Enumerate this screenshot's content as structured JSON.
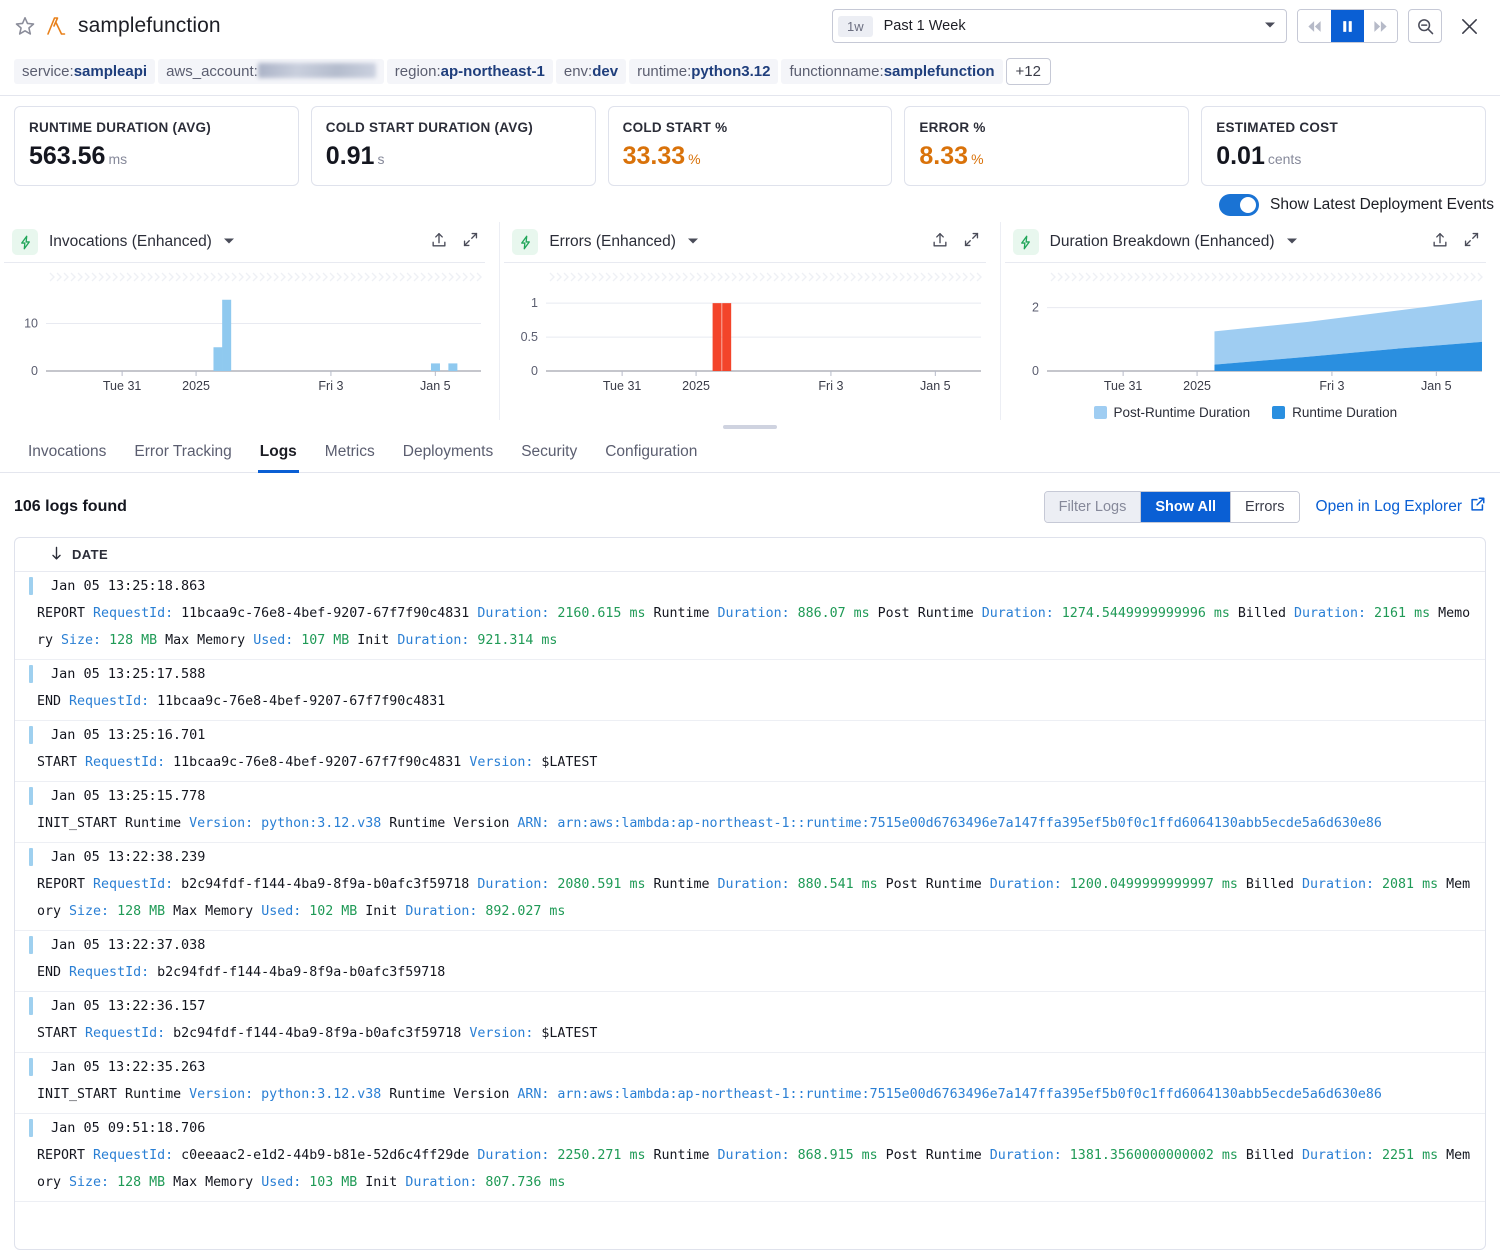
{
  "header": {
    "function_name": "samplefunction",
    "star_icon": "star-icon",
    "lambda_icon": "aws-lambda-icon",
    "timepicker": {
      "badge": "1w",
      "label": "Past 1 Week",
      "caret": "▼"
    },
    "controls": {
      "prev": "⏪",
      "pause": "❚❚",
      "next": "⏩",
      "zoom_out": "zoom-out-icon",
      "close": "✕"
    }
  },
  "tags": [
    {
      "key": "service:",
      "value": "sampleapi",
      "redacted": false
    },
    {
      "key": "aws_account:",
      "value": "",
      "redacted": true
    },
    {
      "key": "region:",
      "value": "ap-northeast-1",
      "redacted": false
    },
    {
      "key": "env:",
      "value": "dev",
      "redacted": false
    },
    {
      "key": "runtime:",
      "value": "python3.12",
      "redacted": false
    },
    {
      "key": "functionname:",
      "value": "samplefunction",
      "redacted": false
    }
  ],
  "tags_more": "+12",
  "cards": [
    {
      "title": "RUNTIME DURATION (AVG)",
      "value": "563.56",
      "unit": "ms",
      "warn": false
    },
    {
      "title": "COLD START DURATION (AVG)",
      "value": "0.91",
      "unit": "s",
      "warn": false
    },
    {
      "title": "COLD START %",
      "value": "33.33",
      "unit": "%",
      "warn": true
    },
    {
      "title": "ERROR %",
      "value": "8.33",
      "unit": "%",
      "warn": true
    },
    {
      "title": "ESTIMATED COST",
      "value": "0.01",
      "unit": "cents",
      "warn": false
    }
  ],
  "deployment_toggle": {
    "label": "Show Latest Deployment Events",
    "on": true,
    "color": "#1a73d4"
  },
  "charts": [
    {
      "title": "Invocations (Enhanced)",
      "icon": "lightning-bolt-icon",
      "caret": "▼",
      "export_icon": "export-icon",
      "expand_icon": "expand-icon"
    },
    {
      "title": "Errors (Enhanced)",
      "icon": "lightning-bolt-icon",
      "caret": "▼",
      "export_icon": "export-icon",
      "expand_icon": "expand-icon"
    },
    {
      "title": "Duration Breakdown (Enhanced)",
      "icon": "lightning-bolt-icon",
      "caret": "▼",
      "export_icon": "export-icon",
      "expand_icon": "expand-icon"
    }
  ],
  "chart_data": [
    {
      "type": "bar",
      "title": "Invocations (Enhanced)",
      "xlabel": "",
      "ylabel": "",
      "x_ticks": [
        "Tue 31",
        "2025",
        "Fri 3",
        "Jan 5"
      ],
      "y_ticks": [
        "0",
        "10"
      ],
      "ylim": [
        0,
        16
      ],
      "grid": true,
      "color": "#8fc9ef",
      "points": [
        {
          "x": 0.385,
          "value": 5
        },
        {
          "x": 0.405,
          "value": 15
        },
        {
          "x": 0.885,
          "value": 1.6
        },
        {
          "x": 0.925,
          "value": 1.6
        }
      ]
    },
    {
      "type": "bar",
      "title": "Errors (Enhanced)",
      "xlabel": "",
      "ylabel": "",
      "x_ticks": [
        "Tue 31",
        "2025",
        "Fri 3",
        "Jan 5"
      ],
      "y_ticks": [
        "0",
        "0.5",
        "1"
      ],
      "ylim": [
        0,
        1.12
      ],
      "grid": true,
      "color": "#f3442a",
      "points": [
        {
          "x": 0.383,
          "value": 1
        },
        {
          "x": 0.405,
          "value": 1
        }
      ]
    },
    {
      "type": "area",
      "title": "Duration Breakdown (Enhanced)",
      "xlabel": "",
      "ylabel": "",
      "x_ticks": [
        "Tue 31",
        "2025",
        "Fri 3",
        "Jan 5"
      ],
      "y_ticks": [
        "0",
        "2"
      ],
      "ylim": [
        0,
        2.4
      ],
      "grid": true,
      "legend_position": "bottom",
      "x": [
        0.385,
        0.6,
        0.8,
        1.0
      ],
      "series": [
        {
          "name": "Runtime Duration",
          "color": "#2a8fe0",
          "values": [
            0.2,
            0.45,
            0.7,
            0.92
          ]
        },
        {
          "name": "Post-Runtime Duration",
          "color": "#9fcdf2",
          "values": [
            1.25,
            1.55,
            1.9,
            2.25
          ]
        }
      ]
    }
  ],
  "tabs": [
    {
      "label": "Invocations",
      "active": false
    },
    {
      "label": "Error Tracking",
      "active": false
    },
    {
      "label": "Logs",
      "active": true
    },
    {
      "label": "Metrics",
      "active": false
    },
    {
      "label": "Deployments",
      "active": false
    },
    {
      "label": "Security",
      "active": false
    },
    {
      "label": "Configuration",
      "active": false
    }
  ],
  "logs_toolbar": {
    "count_text": "106 logs found",
    "filter_label": "Filter Logs",
    "show_all_label": "Show All",
    "errors_label": "Errors",
    "open_explorer_label": "Open in Log Explorer",
    "external_icon": "external-link-icon"
  },
  "log_table": {
    "sort_icon": "↓",
    "date_column": "DATE",
    "entries": [
      {
        "date": "Jan 05 13:25:18.863",
        "parts": [
          {
            "t": "REPORT ",
            "c": "plain"
          },
          {
            "t": "RequestId:",
            "c": "key"
          },
          {
            "t": " 11bcaa9c-76e8-4bef-9207-67f7f90c4831 ",
            "c": "plain"
          },
          {
            "t": "Duration:",
            "c": "key"
          },
          {
            "t": " 2160.615 ms",
            "c": "val"
          },
          {
            "t": " Runtime ",
            "c": "plain"
          },
          {
            "t": "Duration:",
            "c": "key"
          },
          {
            "t": " 886.07 ms",
            "c": "val"
          },
          {
            "t": " Post Runtime ",
            "c": "plain"
          },
          {
            "t": "Duration:",
            "c": "key"
          },
          {
            "t": " 1274.5449999999996 ms",
            "c": "val"
          },
          {
            "t": " Billed ",
            "c": "plain"
          },
          {
            "t": "Duration:",
            "c": "key"
          },
          {
            "t": " 2161 ms",
            "c": "val"
          },
          {
            "t": " Memory ",
            "c": "plain"
          },
          {
            "t": "Size:",
            "c": "key"
          },
          {
            "t": " 128 MB",
            "c": "val"
          },
          {
            "t": " Max Memory ",
            "c": "plain"
          },
          {
            "t": "Used:",
            "c": "key"
          },
          {
            "t": " 107 MB",
            "c": "val"
          },
          {
            "t": " Init ",
            "c": "plain"
          },
          {
            "t": "Duration:",
            "c": "key"
          },
          {
            "t": " 921.314 ms",
            "c": "val"
          }
        ]
      },
      {
        "date": "Jan 05 13:25:17.588",
        "parts": [
          {
            "t": "END ",
            "c": "plain"
          },
          {
            "t": "RequestId:",
            "c": "key"
          },
          {
            "t": " 11bcaa9c-76e8-4bef-9207-67f7f90c4831",
            "c": "plain"
          }
        ]
      },
      {
        "date": "Jan 05 13:25:16.701",
        "parts": [
          {
            "t": "START ",
            "c": "plain"
          },
          {
            "t": "RequestId:",
            "c": "key"
          },
          {
            "t": " 11bcaa9c-76e8-4bef-9207-67f7f90c4831 ",
            "c": "plain"
          },
          {
            "t": "Version:",
            "c": "key"
          },
          {
            "t": " $LATEST",
            "c": "plain"
          }
        ]
      },
      {
        "date": "Jan 05 13:25:15.778",
        "parts": [
          {
            "t": "INIT_START Runtime ",
            "c": "plain"
          },
          {
            "t": "Version:",
            "c": "key"
          },
          {
            "t": " python:3.12.v38",
            "c": "link"
          },
          {
            "t": " Runtime Version ",
            "c": "plain"
          },
          {
            "t": "ARN:",
            "c": "key"
          },
          {
            "t": " arn:aws:lambda:ap-northeast-1::runtime:7515e00d6763496e7a147ffa395ef5b0f0c1ffd6064130abb5ecde5a6d630e86",
            "c": "link"
          }
        ]
      },
      {
        "date": "Jan 05 13:22:38.239",
        "parts": [
          {
            "t": "REPORT ",
            "c": "plain"
          },
          {
            "t": "RequestId:",
            "c": "key"
          },
          {
            "t": " b2c94fdf-f144-4ba9-8f9a-b0afc3f59718 ",
            "c": "plain"
          },
          {
            "t": "Duration:",
            "c": "key"
          },
          {
            "t": " 2080.591 ms",
            "c": "val"
          },
          {
            "t": " Runtime ",
            "c": "plain"
          },
          {
            "t": "Duration:",
            "c": "key"
          },
          {
            "t": " 880.541 ms",
            "c": "val"
          },
          {
            "t": " Post Runtime ",
            "c": "plain"
          },
          {
            "t": "Duration:",
            "c": "key"
          },
          {
            "t": " 1200.0499999999997 ms",
            "c": "val"
          },
          {
            "t": " Billed ",
            "c": "plain"
          },
          {
            "t": "Duration:",
            "c": "key"
          },
          {
            "t": " 2081 ms",
            "c": "val"
          },
          {
            "t": " Memory ",
            "c": "plain"
          },
          {
            "t": "Size:",
            "c": "key"
          },
          {
            "t": " 128 MB",
            "c": "val"
          },
          {
            "t": " Max Memory ",
            "c": "plain"
          },
          {
            "t": "Used:",
            "c": "key"
          },
          {
            "t": " 102 MB",
            "c": "val"
          },
          {
            "t": " Init ",
            "c": "plain"
          },
          {
            "t": "Duration:",
            "c": "key"
          },
          {
            "t": " 892.027 ms",
            "c": "val"
          }
        ]
      },
      {
        "date": "Jan 05 13:22:37.038",
        "parts": [
          {
            "t": "END ",
            "c": "plain"
          },
          {
            "t": "RequestId:",
            "c": "key"
          },
          {
            "t": " b2c94fdf-f144-4ba9-8f9a-b0afc3f59718",
            "c": "plain"
          }
        ]
      },
      {
        "date": "Jan 05 13:22:36.157",
        "parts": [
          {
            "t": "START ",
            "c": "plain"
          },
          {
            "t": "RequestId:",
            "c": "key"
          },
          {
            "t": " b2c94fdf-f144-4ba9-8f9a-b0afc3f59718 ",
            "c": "plain"
          },
          {
            "t": "Version:",
            "c": "key"
          },
          {
            "t": " $LATEST",
            "c": "plain"
          }
        ]
      },
      {
        "date": "Jan 05 13:22:35.263",
        "parts": [
          {
            "t": "INIT_START Runtime ",
            "c": "plain"
          },
          {
            "t": "Version:",
            "c": "key"
          },
          {
            "t": " python:3.12.v38",
            "c": "link"
          },
          {
            "t": " Runtime Version ",
            "c": "plain"
          },
          {
            "t": "ARN:",
            "c": "key"
          },
          {
            "t": " arn:aws:lambda:ap-northeast-1::runtime:7515e00d6763496e7a147ffa395ef5b0f0c1ffd6064130abb5ecde5a6d630e86",
            "c": "link"
          }
        ]
      },
      {
        "date": "Jan 05 09:51:18.706",
        "parts": [
          {
            "t": "REPORT ",
            "c": "plain"
          },
          {
            "t": "RequestId:",
            "c": "key"
          },
          {
            "t": " c0eeaac2-e1d2-44b9-b81e-52d6c4ff29de ",
            "c": "plain"
          },
          {
            "t": "Duration:",
            "c": "key"
          },
          {
            "t": " 2250.271 ms",
            "c": "val"
          },
          {
            "t": " Runtime ",
            "c": "plain"
          },
          {
            "t": "Duration:",
            "c": "key"
          },
          {
            "t": " 868.915 ms",
            "c": "val"
          },
          {
            "t": " Post Runtime ",
            "c": "plain"
          },
          {
            "t": "Duration:",
            "c": "key"
          },
          {
            "t": " 1381.3560000000002 ms",
            "c": "val"
          },
          {
            "t": " Billed ",
            "c": "plain"
          },
          {
            "t": "Duration:",
            "c": "key"
          },
          {
            "t": " 2251 ms",
            "c": "val"
          },
          {
            "t": " Memory ",
            "c": "plain"
          },
          {
            "t": "Size:",
            "c": "key"
          },
          {
            "t": " 128 MB",
            "c": "val"
          },
          {
            "t": " Max Memory ",
            "c": "plain"
          },
          {
            "t": "Used:",
            "c": "key"
          },
          {
            "t": " 103 MB",
            "c": "val"
          },
          {
            "t": " Init ",
            "c": "plain"
          },
          {
            "t": "Duration:",
            "c": "key"
          },
          {
            "t": " 807.736 ms",
            "c": "val"
          }
        ]
      }
    ]
  }
}
